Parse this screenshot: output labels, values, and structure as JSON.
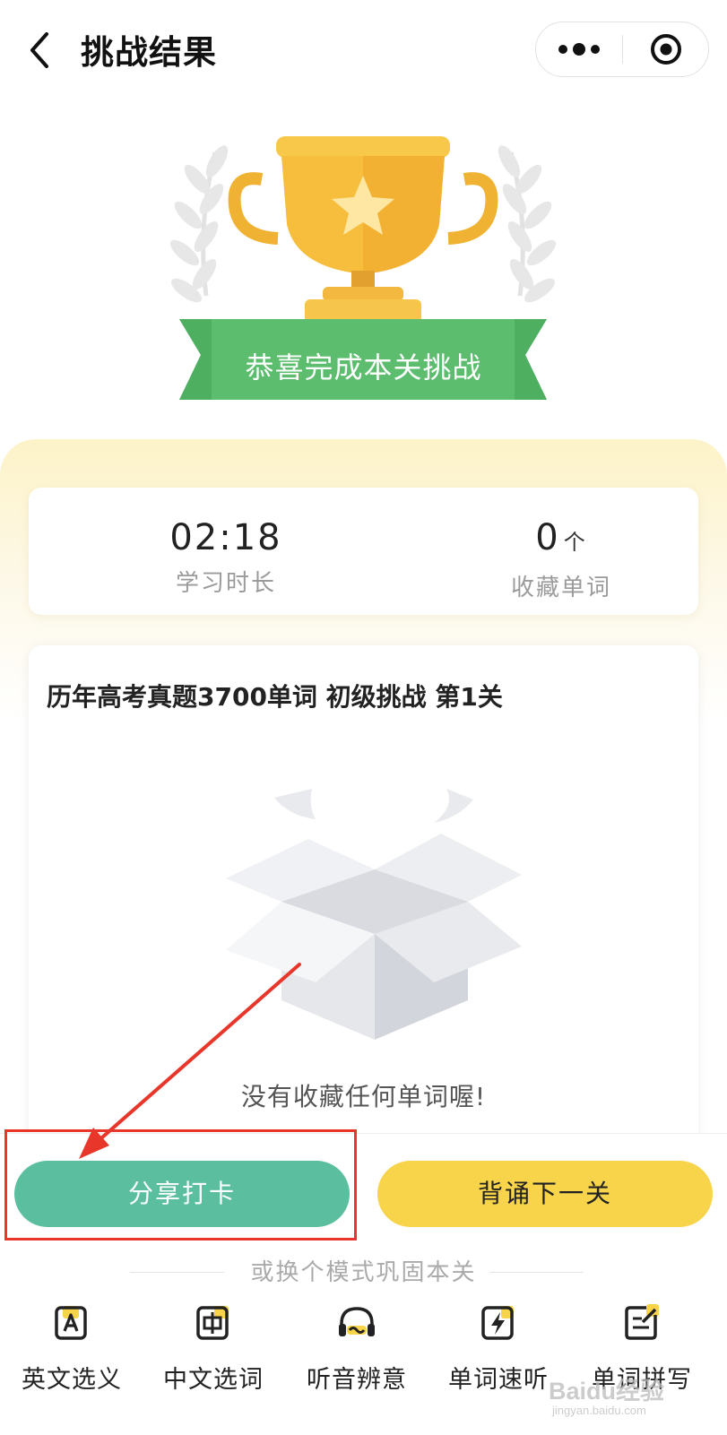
{
  "header": {
    "title": "挑战结果"
  },
  "banner": {
    "ribbon_text": "恭喜完成本关挑战"
  },
  "stats": {
    "duration": {
      "value": "02:18",
      "label": "学习时长"
    },
    "collected": {
      "value": "0",
      "unit": "个",
      "label": "收藏单词"
    }
  },
  "words_card": {
    "title": "历年高考真题3700单词 初级挑战 第1关",
    "empty_message": "没有收藏任何单词喔!"
  },
  "actions": {
    "share_label": "分享打卡",
    "next_label": "背诵下一关"
  },
  "modes": {
    "divider_text": "或换个模式巩固本关",
    "items": [
      {
        "label": "英文选义",
        "icon": "letter-a-icon"
      },
      {
        "label": "中文选词",
        "icon": "chinese-char-icon"
      },
      {
        "label": "听音辨意",
        "icon": "headphones-icon"
      },
      {
        "label": "单词速听",
        "icon": "lightning-icon"
      },
      {
        "label": "单词拼写",
        "icon": "pencil-note-icon"
      }
    ]
  },
  "watermark": {
    "text": "Baidu经验",
    "sub": "jingyan.baidu.com"
  },
  "colors": {
    "share_button": "#5bbf9f",
    "next_button": "#f7d44a",
    "ribbon": "#5cbd6e",
    "trophy": "#f6be3c",
    "annotation_red": "#e8372a"
  }
}
